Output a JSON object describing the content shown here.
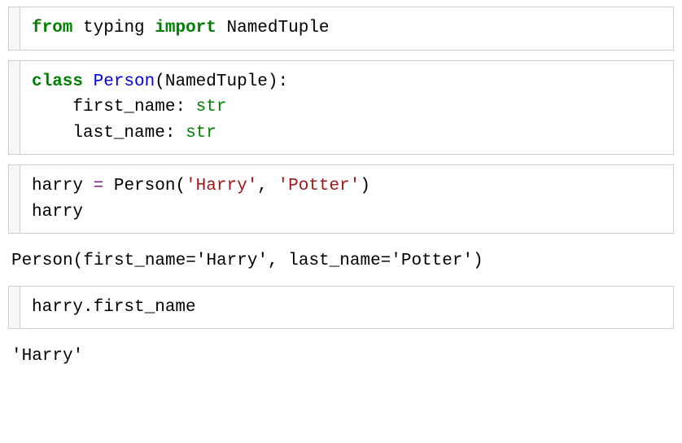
{
  "cells": {
    "c1": {
      "kw_from": "from",
      "mod": "typing",
      "kw_import": "import",
      "name": "NamedTuple"
    },
    "c2": {
      "kw_class": "class",
      "class_name": "Person",
      "base": "NamedTuple",
      "colon1": ":",
      "field1": "first_name",
      "type1": "str",
      "field2": "last_name",
      "type2": "str"
    },
    "c3": {
      "var": "harry",
      "eq": "=",
      "call": "Person",
      "arg1": "'Harry'",
      "comma": ",",
      "arg2": "'Potter'",
      "line2": "harry"
    },
    "out1": "Person(first_name='Harry', last_name='Potter')",
    "c4": {
      "expr": "harry.first_name"
    },
    "out2": "'Harry'"
  }
}
